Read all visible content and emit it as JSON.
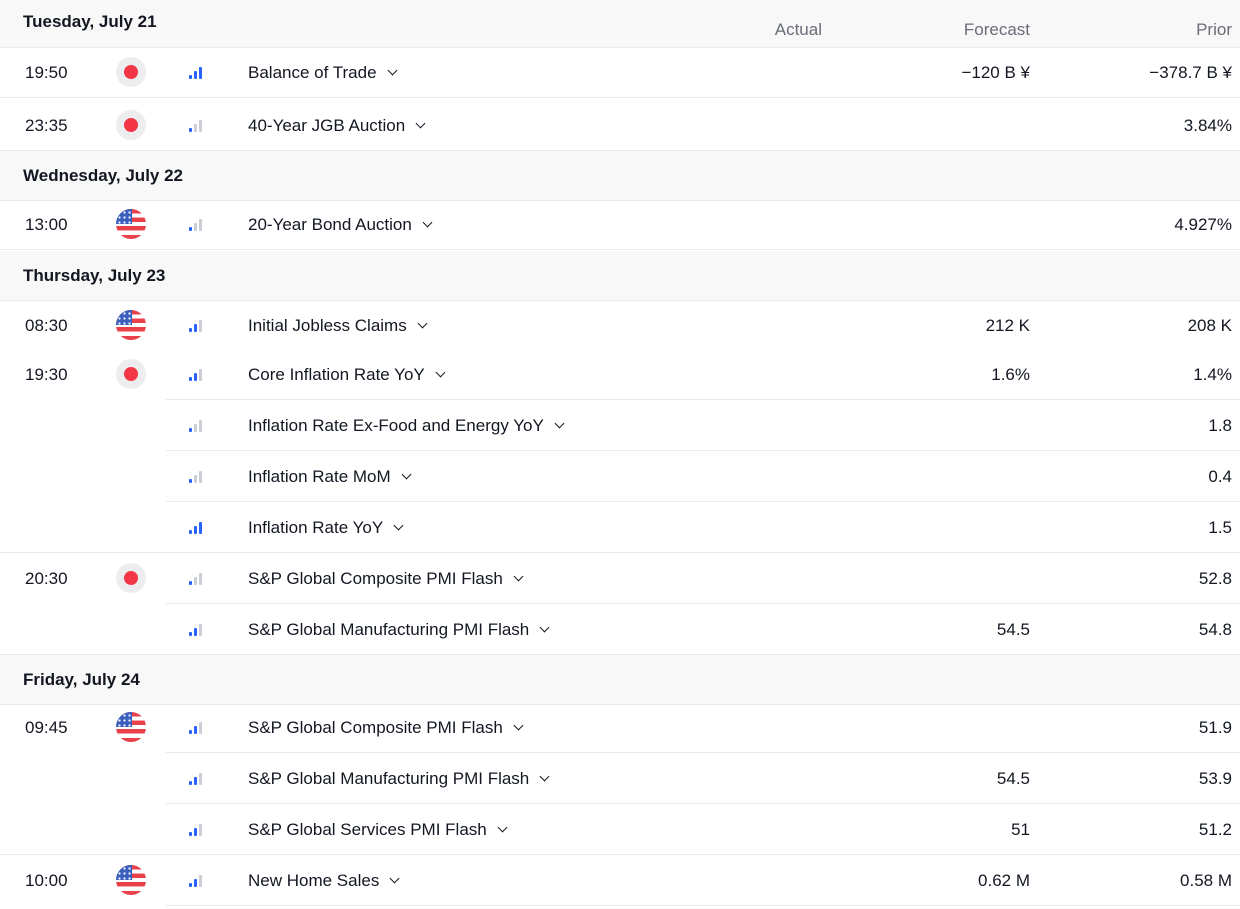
{
  "columns": {
    "actual": "Actual",
    "forecast": "Forecast",
    "prior": "Prior"
  },
  "colors": {
    "jp_flag_red": "#f23645",
    "us_flag_red": "#e9404a",
    "us_flag_blue": "#3b5fbf",
    "importance_active": "#2962ff",
    "importance_inactive": "#c9cdd6"
  },
  "days": [
    {
      "date": "Tuesday, July 21",
      "events": [
        {
          "time": "19:50",
          "country": "JP",
          "importance": 3,
          "name": "Balance of Trade",
          "actual": "",
          "forecast": "−120 B ¥",
          "prior": "−378.7 B ¥"
        },
        {
          "time": "23:35",
          "country": "JP",
          "importance": 1,
          "name": "40-Year JGB Auction",
          "actual": "",
          "forecast": "",
          "prior": "3.84%"
        }
      ]
    },
    {
      "date": "Wednesday, July 22",
      "events": [
        {
          "time": "13:00",
          "country": "US",
          "importance": 1,
          "name": "20-Year Bond Auction",
          "actual": "",
          "forecast": "",
          "prior": "4.927%"
        }
      ]
    },
    {
      "date": "Thursday, July 23",
      "events": [
        {
          "time": "08:30",
          "country": "US",
          "importance": 2,
          "name": "Initial Jobless Claims",
          "actual": "",
          "forecast": "212 K",
          "prior": "208 K"
        },
        {
          "time": "19:30",
          "country": "JP",
          "importance": 2,
          "name": "Core Inflation Rate YoY",
          "actual": "",
          "forecast": "1.6%",
          "prior": "1.4%"
        },
        {
          "time": "",
          "country": "",
          "importance": 1,
          "name": "Inflation Rate Ex-Food and Energy YoY",
          "actual": "",
          "forecast": "",
          "prior": "1.8"
        },
        {
          "time": "",
          "country": "",
          "importance": 1,
          "name": "Inflation Rate MoM",
          "actual": "",
          "forecast": "",
          "prior": "0.4"
        },
        {
          "time": "",
          "country": "",
          "importance": 3,
          "name": "Inflation Rate YoY",
          "actual": "",
          "forecast": "",
          "prior": "1.5"
        },
        {
          "time": "20:30",
          "country": "JP",
          "importance": 1,
          "name": "S&P Global Composite PMI Flash",
          "actual": "",
          "forecast": "",
          "prior": "52.8"
        },
        {
          "time": "",
          "country": "",
          "importance": 2,
          "name": "S&P Global Manufacturing PMI Flash",
          "actual": "",
          "forecast": "54.5",
          "prior": "54.8"
        }
      ]
    },
    {
      "date": "Friday, July 24",
      "events": [
        {
          "time": "09:45",
          "country": "US",
          "importance": 2,
          "name": "S&P Global Composite PMI Flash",
          "actual": "",
          "forecast": "",
          "prior": "51.9"
        },
        {
          "time": "",
          "country": "",
          "importance": 2,
          "name": "S&P Global Manufacturing PMI Flash",
          "actual": "",
          "forecast": "54.5",
          "prior": "53.9"
        },
        {
          "time": "",
          "country": "",
          "importance": 2,
          "name": "S&P Global Services PMI Flash",
          "actual": "",
          "forecast": "51",
          "prior": "51.2"
        },
        {
          "time": "10:00",
          "country": "US",
          "importance": 2,
          "name": "New Home Sales",
          "actual": "",
          "forecast": "0.62 M",
          "prior": "0.58 M"
        }
      ]
    }
  ]
}
